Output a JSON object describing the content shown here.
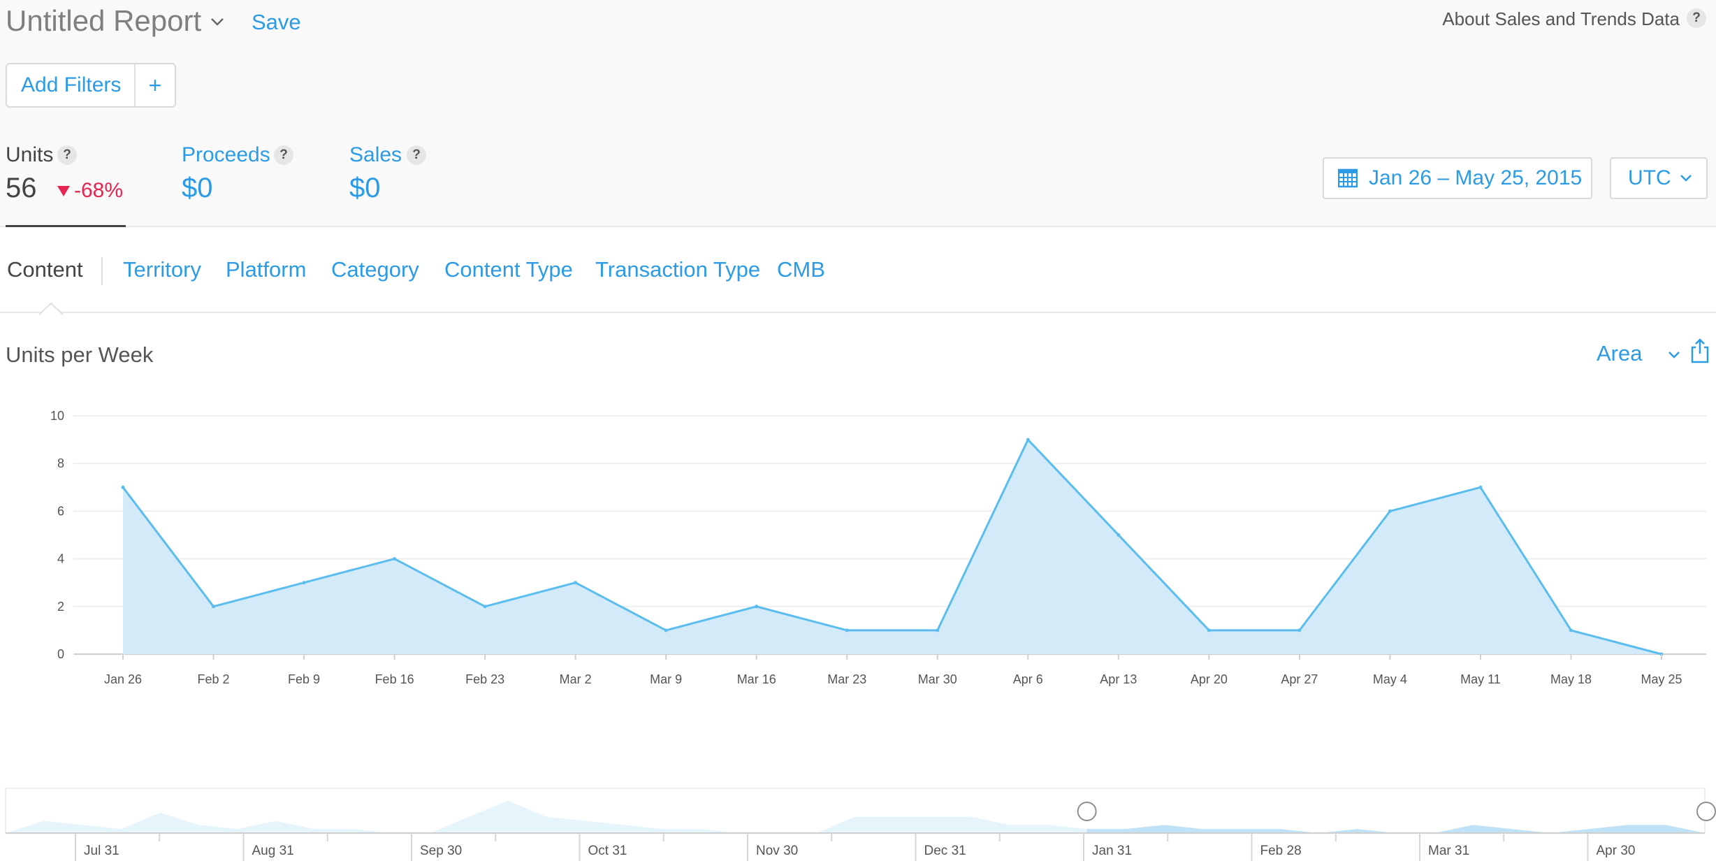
{
  "header": {
    "title": "Untitled Report",
    "save_label": "Save",
    "about_label": "About Sales and Trends Data",
    "help_glyph": "?"
  },
  "filters": {
    "label": "Add Filters",
    "add_glyph": "+"
  },
  "metrics": {
    "units": {
      "label": "Units",
      "value": "56",
      "delta": "-68%",
      "delta_color": "#e5254f"
    },
    "proceeds": {
      "label": "Proceeds",
      "value": "$0"
    },
    "sales": {
      "label": "Sales",
      "value": "$0"
    }
  },
  "date_range": {
    "label": "Jan 26 – May 25, 2015",
    "icon": "calendar-icon"
  },
  "timezone": {
    "label": "UTC"
  },
  "tabs": [
    {
      "label": "Content",
      "active": true
    },
    {
      "label": "Territory"
    },
    {
      "label": "Platform"
    },
    {
      "label": "Category"
    },
    {
      "label": "Content Type"
    },
    {
      "label": "Transaction Type"
    },
    {
      "label": "CMB"
    }
  ],
  "chart_header": {
    "title": "Units per Week",
    "type_label": "Area",
    "share_icon": "share-icon"
  },
  "colors": {
    "accent": "#2b9be6",
    "series_line": "#5bbdee",
    "series_fill": "#d3ebf8",
    "negative": "#e5254f"
  },
  "chart_data": {
    "type": "area",
    "title": "Units per Week",
    "x": [
      "Jan 26",
      "Feb 2",
      "Feb 9",
      "Feb 16",
      "Feb 23",
      "Mar 2",
      "Mar 9",
      "Mar 16",
      "Mar 23",
      "Mar 30",
      "Apr 6",
      "Apr 13",
      "Apr 20",
      "Apr 27",
      "May 4",
      "May 11",
      "May 18",
      "May 25"
    ],
    "values": [
      7,
      2,
      3,
      4,
      2,
      3,
      1,
      2,
      1,
      1,
      9,
      5,
      1,
      1,
      6,
      7,
      1,
      0
    ],
    "ylim": [
      0,
      10
    ],
    "yticks": [
      0,
      2,
      4,
      6,
      8,
      10
    ],
    "grid": true,
    "legend": "none"
  },
  "navigator": {
    "tick_labels": [
      "Jul 31",
      "Aug 31",
      "Sep 30",
      "Oct 31",
      "Nov 30",
      "Dec 31",
      "Jan 31",
      "Feb 28",
      "Mar 31",
      "Apr 30"
    ],
    "values": [
      0,
      3,
      2,
      1,
      5,
      2,
      1,
      3,
      1,
      1,
      0,
      0,
      4,
      8,
      4,
      3,
      2,
      1,
      1,
      0,
      0,
      0,
      4,
      4,
      4,
      4,
      2,
      2,
      1,
      1,
      2,
      1,
      1,
      1,
      0,
      1,
      0,
      0,
      2,
      1,
      0,
      1,
      2,
      2,
      0
    ],
    "selection_start_index": 28,
    "max": 10
  }
}
